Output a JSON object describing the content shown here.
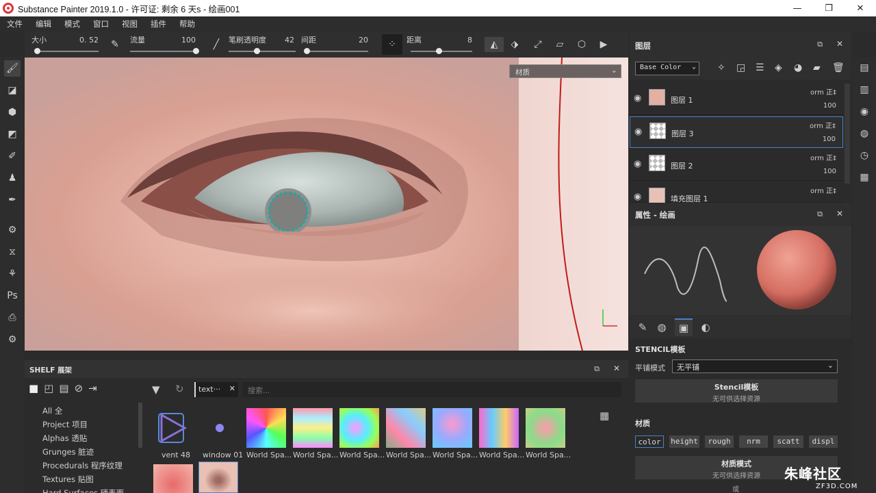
{
  "window": {
    "title": "Substance Painter 2019.1.0 - 许可证: 剩余 6 天s - 绘画001",
    "minimize": "—",
    "maximize": "❐",
    "close": "✕"
  },
  "menu": [
    "文件",
    "编辑",
    "模式",
    "窗口",
    "视图",
    "插件",
    "帮助"
  ],
  "toolbar": {
    "size": {
      "label": "大小",
      "value": "0. 52",
      "level": 0.02
    },
    "flow": {
      "label": "流量",
      "value": "100",
      "level": 1.0
    },
    "opacity": {
      "label": "笔刷透明度",
      "value": "42",
      "level": 0.42
    },
    "spacing": {
      "label": "间距",
      "value": "20",
      "level": 0.0
    },
    "distance": {
      "label": "距离",
      "value": "8",
      "level": 0.45
    }
  },
  "viewport": {
    "material_select": "材质"
  },
  "shelf": {
    "title": "SHELF 展架",
    "filter_tag": "text···",
    "search_placeholder": "搜索...",
    "categories": [
      "All 全",
      "Project 项目",
      "Alphas 透贴",
      "Grunges 脏迹",
      "Procedurals 程序纹理",
      "Textures 贴图",
      "Hard Surfaces 硬表面"
    ],
    "items": [
      "vent 48",
      "window 01",
      "World Spa...",
      "World Spa...",
      "World Spa...",
      "World Spa...",
      "World Spa...",
      "World Spa...",
      "World Spa..."
    ]
  },
  "layers": {
    "title": "图层",
    "channel": "Base Color",
    "rows": [
      {
        "name": "图层 1",
        "blend": "orm 正‡",
        "opacity": "100"
      },
      {
        "name": "图层 3",
        "blend": "orm 正‡",
        "opacity": "100"
      },
      {
        "name": "图层 2",
        "blend": "orm 正‡",
        "opacity": "100"
      },
      {
        "name": "填充图层 1",
        "blend": "orm 正‡",
        "opacity": ""
      }
    ]
  },
  "properties": {
    "title": "属性 - 绘画",
    "stencil_title": "STENCIL模板",
    "tiling_label": "平铺模式",
    "tiling_value": "无平铺",
    "stencil_box_title": "Stencil模板",
    "stencil_box_sub": "无可供选择资源",
    "material_title": "材质",
    "channels": [
      "color",
      "height",
      "rough",
      "nrm",
      "scatt",
      "displ"
    ],
    "material_mode_title": "材质模式",
    "material_mode_sub": "无可供选择资源",
    "or_label": "或"
  },
  "watermark": {
    "big": "朱峰社区",
    "small": "ZF3D.COM"
  }
}
